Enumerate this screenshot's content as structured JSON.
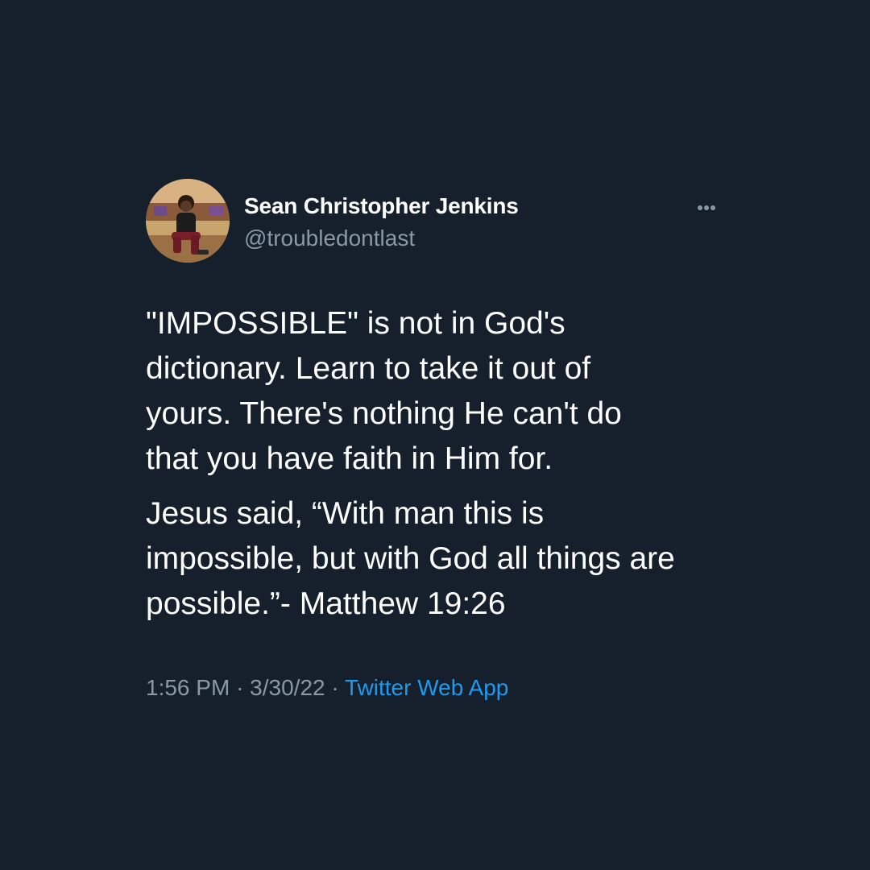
{
  "tweet": {
    "author": {
      "display_name": "Sean Christopher Jenkins",
      "handle": "@troubledontlast"
    },
    "text_paragraphs": [
      "\"IMPOSSIBLE\" is not in God's\ndictionary. Learn to take it out of\nyours. There's nothing He can't do\nthat you have faith in Him for.",
      "Jesus said, “With man this is\nimpossible, but with God all things are\npossible.”- Matthew 19:26"
    ],
    "time": "1:56 PM",
    "separator": "·",
    "date": "3/30/22",
    "source": "Twitter Web App",
    "more_icon": "more-horizontal-icon"
  },
  "colors": {
    "background": "#16202c",
    "text_primary": "#ffffff",
    "text_secondary": "#8b98a5",
    "link": "#1d9bf0"
  }
}
